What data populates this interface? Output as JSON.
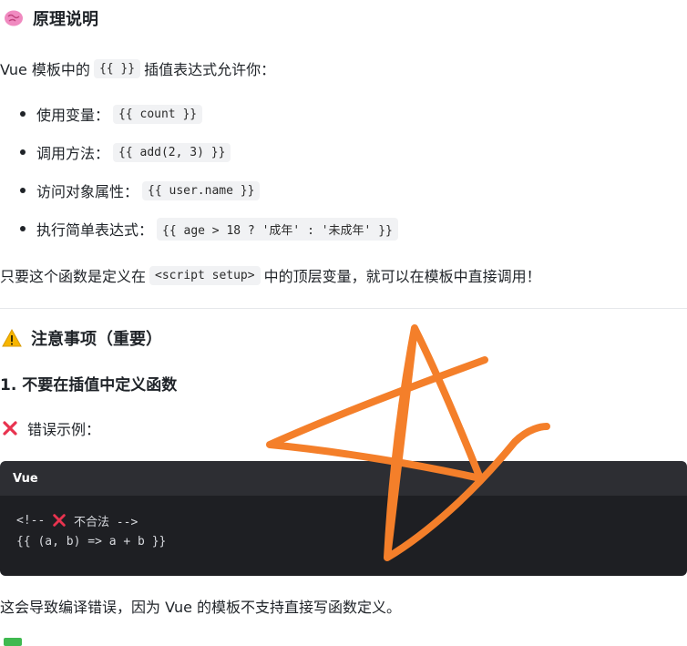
{
  "section1": {
    "emoji": "brain-icon",
    "title": "原理说明",
    "intro_before": "Vue 模板中的",
    "intro_code": "{{ }}",
    "intro_after": "插值表达式允许你：",
    "bullets": [
      {
        "label": "使用变量：",
        "code": "{{ count }}"
      },
      {
        "label": "调用方法：",
        "code": "{{ add(2, 3) }}"
      },
      {
        "label": "访问对象属性：",
        "code": "{{ user.name }}"
      },
      {
        "label": "执行简单表达式：",
        "code": "{{ age > 18 ? '成年' : '未成年' }}"
      }
    ],
    "summary_before": "只要这个函数是定义在",
    "summary_code": "<script setup>",
    "summary_after": "中的顶层变量，就可以在模板中直接调用！"
  },
  "section2": {
    "emoji": "warning-icon",
    "title": "注意事项（重要）",
    "subheading": "1. 不要在插值中定义函数",
    "wrong_emoji": "cross-mark-icon",
    "wrong_label": "错误示例：",
    "codeblock": {
      "language": "Vue",
      "line1_prefix": "<!-- ",
      "line1_text": " 不合法 -->",
      "line2": "{{ (a, b) => a + b }}"
    },
    "explanation": "这会导致编译错误，因为 Vue 的模板不支持直接写函数定义。"
  },
  "colors": {
    "annotation": "#f47f2a",
    "code_bg": "#1e1f23",
    "code_header": "#2d2e33",
    "cross": "#e8334f"
  }
}
